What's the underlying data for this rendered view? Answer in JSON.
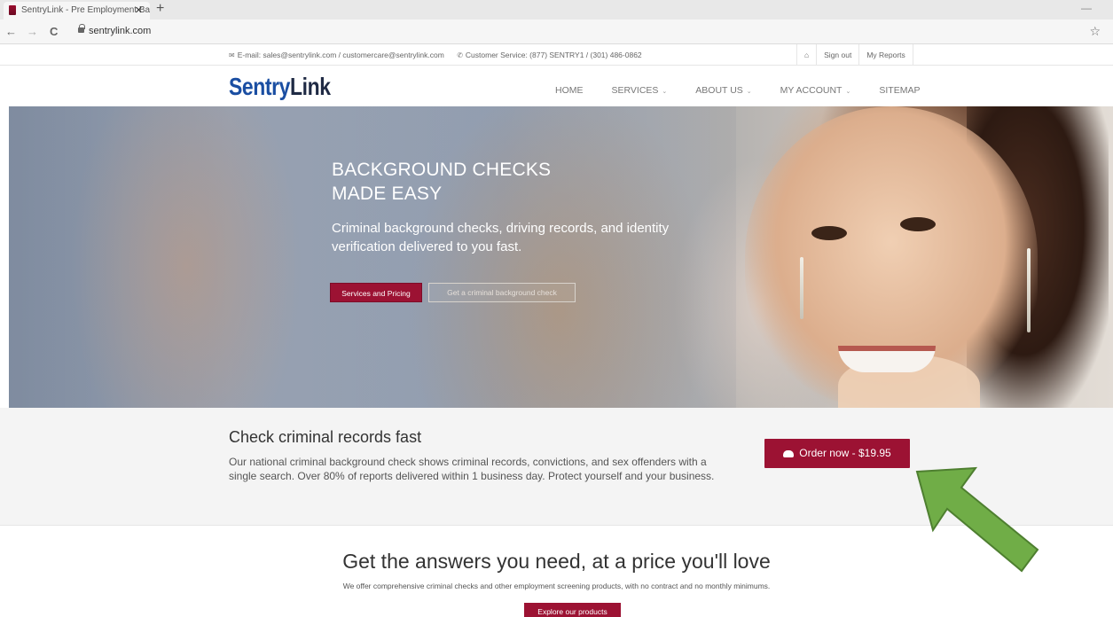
{
  "browser": {
    "tab_title": "SentryLink - Pre Employment Ba",
    "tab_close": "✕",
    "new_tab": "+",
    "back": "←",
    "forward": "→",
    "reload": "C",
    "url": "sentrylink.com",
    "bookmark": "☆",
    "minimize": "—"
  },
  "topbar": {
    "email": "E-mail: sales@sentrylink.com / customercare@sentrylink.com",
    "phone": "Customer Service: (877) SENTRY1 / (301) 486-0862",
    "home_icon": "⌂",
    "sign_out": "Sign out",
    "my_reports": "My Reports"
  },
  "logo": {
    "part1": "Sentry",
    "part2": "Link"
  },
  "nav": {
    "home": "HOME",
    "services": "SERVICES",
    "about": "ABOUT US",
    "account": "MY ACCOUNT",
    "sitemap": "SITEMAP",
    "caret": "⌄"
  },
  "hero": {
    "title_line1": "BACKGROUND CHECKS",
    "title_line2": "MADE EASY",
    "subtitle": "Criminal background checks, driving records, and identity verification delivered to you fast.",
    "btn_services": "Services and Pricing",
    "btn_check": "Get a criminal background check"
  },
  "promo": {
    "title": "Check criminal records fast",
    "text": "Our national criminal background check shows criminal records, convictions, and sex offenders with a single search. Over 80% of reports delivered within 1 business day. Protect yourself and your business.",
    "order_button": "Order now - $19.95"
  },
  "section": {
    "title": "Get the answers you need, at a price you'll love",
    "text": "We offer comprehensive criminal checks and other employment screening products, with no contract and no monthly minimums.",
    "button": "Explore our products"
  },
  "colors": {
    "brand_red": "#9c1233",
    "logo_blue": "#1a4ea2",
    "logo_dark": "#1f2a44",
    "arrow_green": "#70ad47"
  }
}
